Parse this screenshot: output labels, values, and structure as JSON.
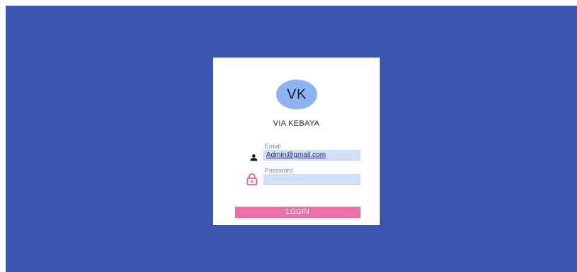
{
  "app": {
    "avatar_initials": "VK",
    "brand_name": "VIA KEBAYA"
  },
  "form": {
    "email_label": "Email",
    "email_value": "Admin@gmail.com",
    "password_label": "Password",
    "password_value": "····························",
    "login_label": "LOGIN"
  },
  "icons": {
    "email": "person-icon",
    "password": "lock-icon"
  },
  "colors": {
    "background": "#3c55b0",
    "card": "#ffffff",
    "avatar": "#8db4f0",
    "input_fill": "#cfe0f8",
    "login_button": "#ec6fa5",
    "lock_icon": "#e0609a"
  }
}
